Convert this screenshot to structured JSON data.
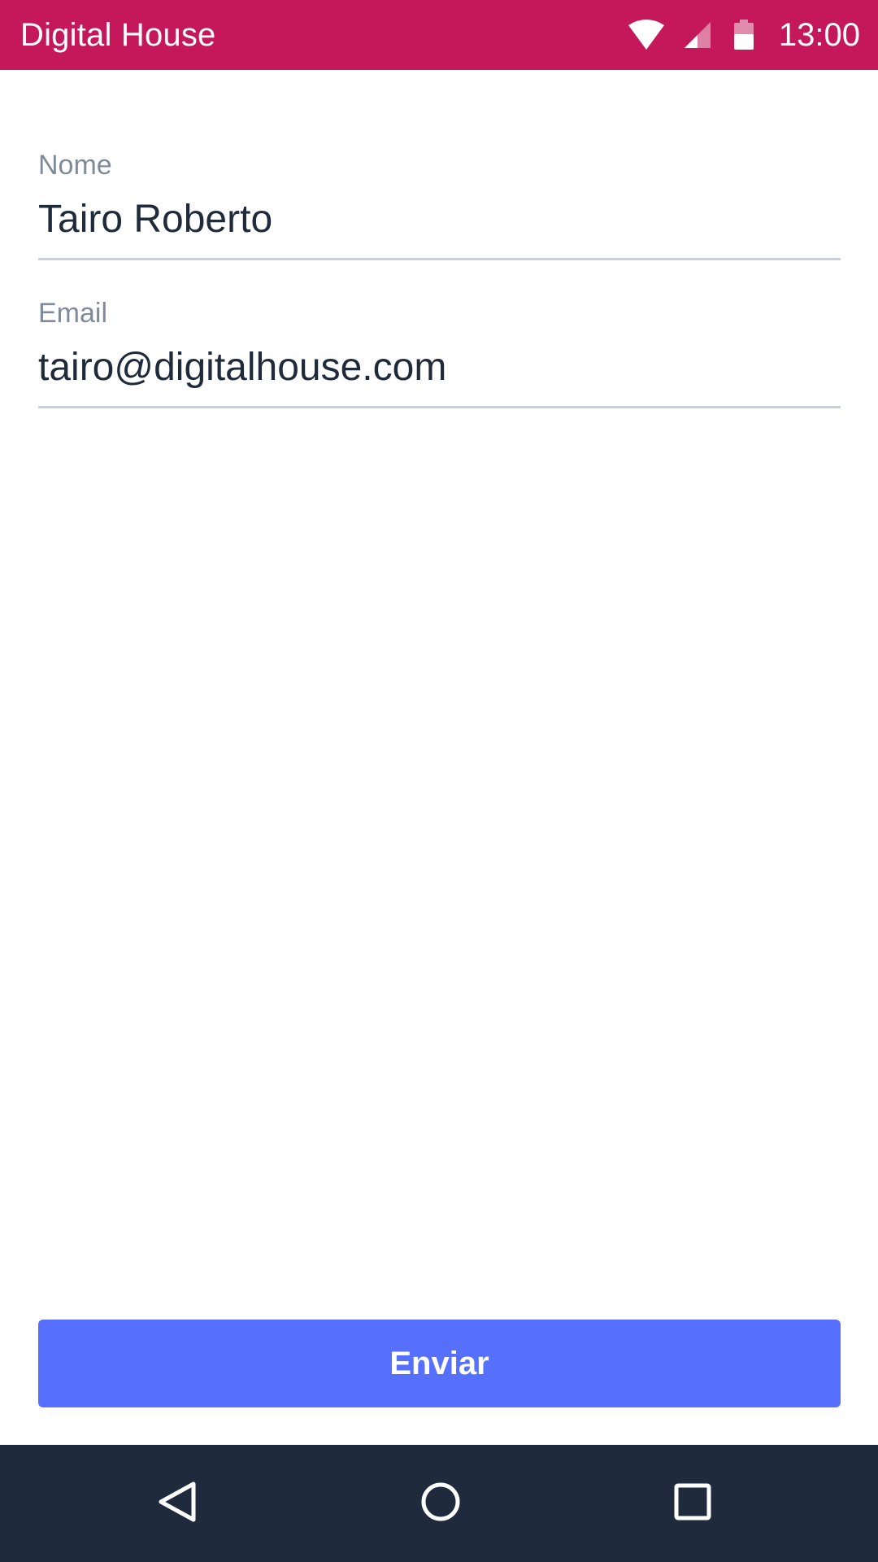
{
  "app": {
    "title": "Digital House",
    "theme_color": "#c4185a",
    "accent_color": "#566ffc"
  },
  "status_bar": {
    "time": "13:00",
    "icons": [
      "wifi-icon",
      "signal-icon",
      "battery-icon"
    ]
  },
  "form": {
    "name_field": {
      "label": "Nome",
      "value": "Tairo Roberto"
    },
    "email_field": {
      "label": "Email",
      "value": "tairo@digitalhouse.com"
    }
  },
  "submit_button": {
    "label": "Enviar"
  },
  "nav_bar": {
    "icons": [
      "back-icon",
      "home-icon",
      "recent-apps-icon"
    ]
  }
}
